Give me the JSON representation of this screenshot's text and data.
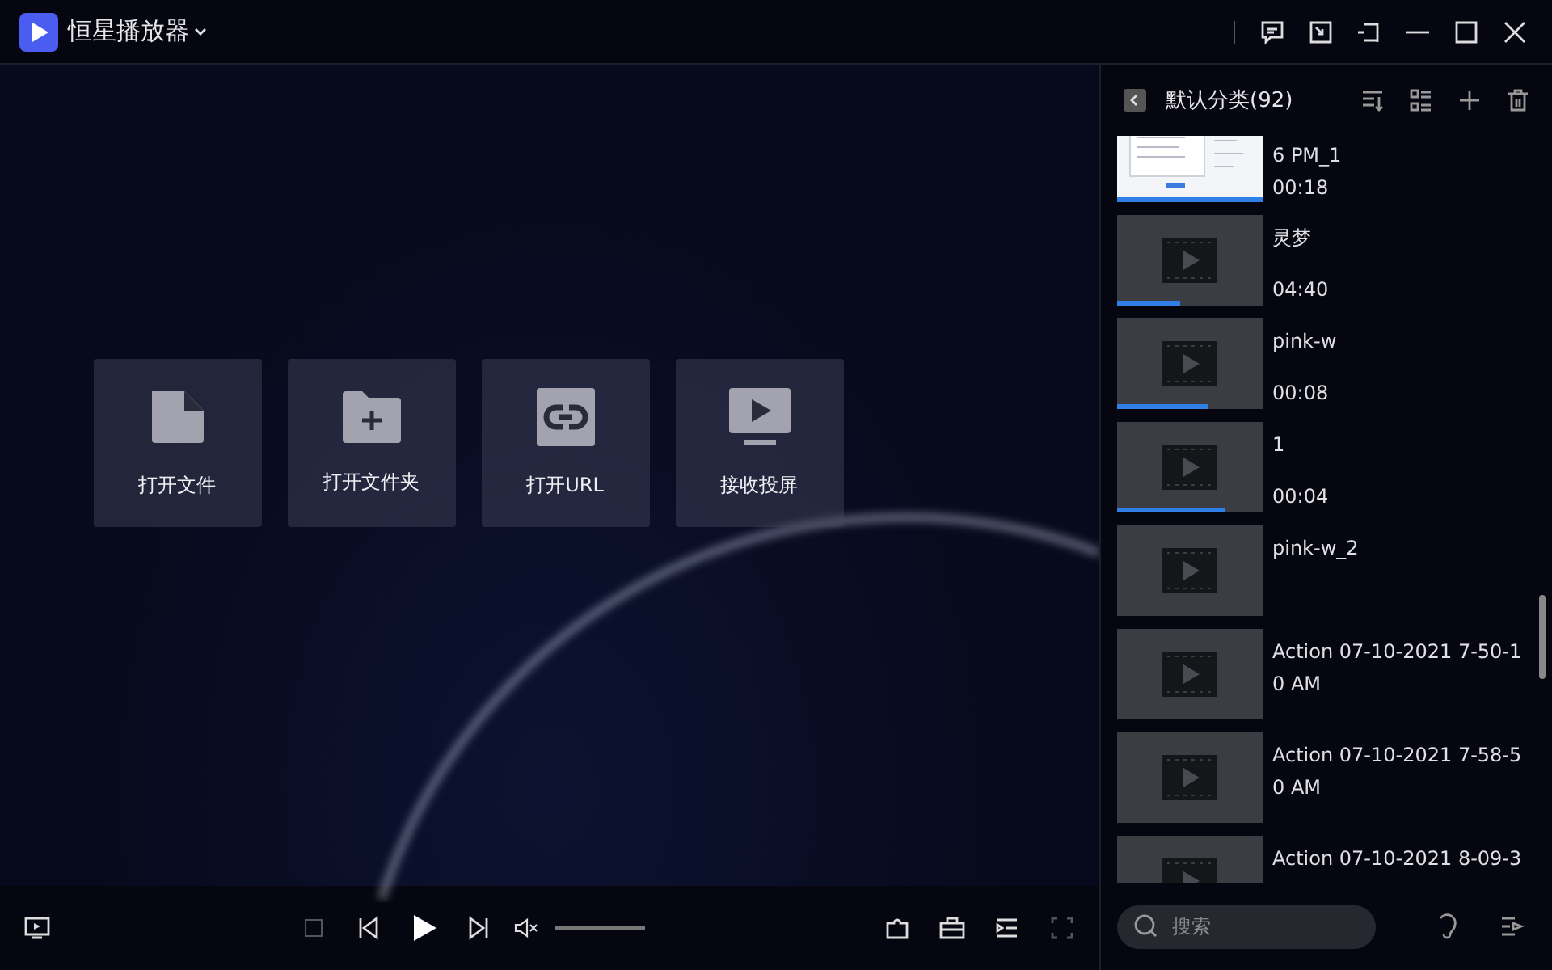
{
  "app": {
    "title": "恒星播放器"
  },
  "actions": [
    {
      "label": "打开文件",
      "kind": "file"
    },
    {
      "label": "打开文件夹",
      "kind": "folder"
    },
    {
      "label": "打开URL",
      "kind": "link"
    },
    {
      "label": "接收投屏",
      "kind": "cast"
    }
  ],
  "volume": {
    "level": 0
  },
  "playlist": {
    "title": "默认分类(92)",
    "search": {
      "placeholder": "搜索"
    },
    "items": [
      {
        "title": "6 PM_1",
        "duration": "00:18",
        "kind": "screenshot",
        "level": 1
      },
      {
        "title": "灵梦",
        "duration": "04:40",
        "kind": "video",
        "level": 0.43
      },
      {
        "title": "pink-w",
        "duration": "00:08",
        "kind": "video",
        "level": 0.62
      },
      {
        "title": "1",
        "duration": "00:04",
        "kind": "video",
        "level": 0.74
      },
      {
        "title": "pink-w_2",
        "kind": "video"
      },
      {
        "title": "Action 07-10-2021 7-50-10 AM",
        "kind": "video"
      },
      {
        "title": "Action 07-10-2021 7-58-50 AM",
        "kind": "video"
      },
      {
        "title": "Action 07-10-2021 8-09-3",
        "kind": "video"
      }
    ]
  }
}
